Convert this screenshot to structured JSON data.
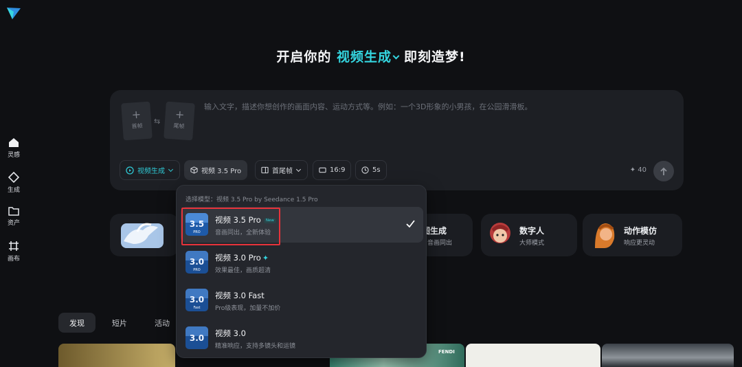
{
  "sidebar": {
    "items": [
      {
        "label": "灵感",
        "icon": "home-icon"
      },
      {
        "label": "生成",
        "icon": "diamond-icon"
      },
      {
        "label": "资产",
        "icon": "folder-icon"
      },
      {
        "label": "画布",
        "icon": "canvas-icon"
      }
    ]
  },
  "headline": {
    "prefix": "开启你的",
    "mode": "视频生成",
    "suffix": "即刻造梦!"
  },
  "composer": {
    "start_frame_label": "首帧",
    "end_frame_label": "尾帧",
    "placeholder": "输入文字，描述你想创作的画面内容、运动方式等。例如：一个3D形象的小男孩，在公园滑滑板。",
    "mode_label": "视频生成",
    "model_label": "视频 3.5 Pro",
    "frame_mode_label": "首尾帧",
    "ratio_label": "16:9",
    "duration_label": "5s",
    "credits": "40"
  },
  "features": [
    {
      "title": "图生成",
      "sub": "音画同出"
    },
    {
      "title": "数字人",
      "sub": "大师模式"
    },
    {
      "title": "动作模仿",
      "sub": "响应更灵动"
    }
  ],
  "tabs": [
    "发现",
    "短片",
    "活动"
  ],
  "thumbs": {
    "fendi_label": "FENDI"
  },
  "model_menu": {
    "header": "选择模型：视频 3.5 Pro by Seedance 1.5 Pro",
    "options": [
      {
        "name": "视频 3.5 Pro",
        "badge": "New",
        "desc": "音画同出，全新体验",
        "icon_text": "3.5",
        "icon_sub": "PRO",
        "selected": true
      },
      {
        "name": "视频 3.0 Pro",
        "desc": "效果最佳，画质超清",
        "icon_text": "3.0",
        "icon_sub": "PRO",
        "selected": false
      },
      {
        "name": "视频 3.0 Fast",
        "desc": "Pro级表现，加量不加价",
        "icon_text": "3.0",
        "icon_sub": "Fast",
        "selected": false
      },
      {
        "name": "视频 3.0",
        "desc": "精准响应，支持多镜头和运镜",
        "icon_text": "3.0",
        "icon_sub": "",
        "selected": false
      }
    ]
  },
  "colors": {
    "accent": "#34d6e0",
    "highlight": "#e8333b",
    "background": "#0f1013"
  }
}
